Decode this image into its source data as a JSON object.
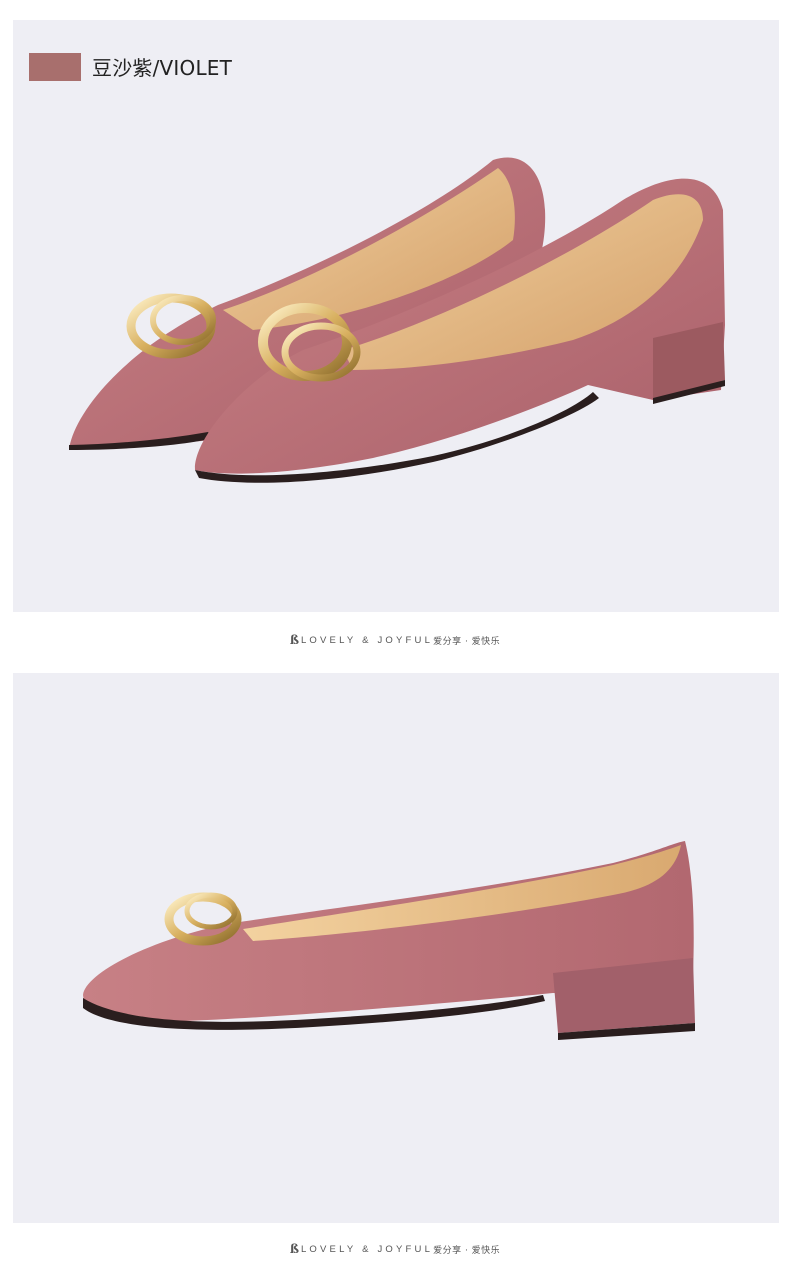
{
  "color_option": {
    "label": "豆沙紫/VIOLET",
    "swatch_color": "#a86f6d"
  },
  "brand_tagline": {
    "logo_glyph": "ß",
    "english": "LOVELY & JOYFUL",
    "chinese": "爱分享 · 爱快乐"
  },
  "photos": [
    {
      "subject": "pair-of-pointed-flats-front-view"
    },
    {
      "subject": "single-pointed-flat-side-view"
    }
  ],
  "colors": {
    "panel_background": "#eeeef4",
    "suede": "#b86f72",
    "lining": "#e3bb86",
    "gold": "#d8b060"
  }
}
